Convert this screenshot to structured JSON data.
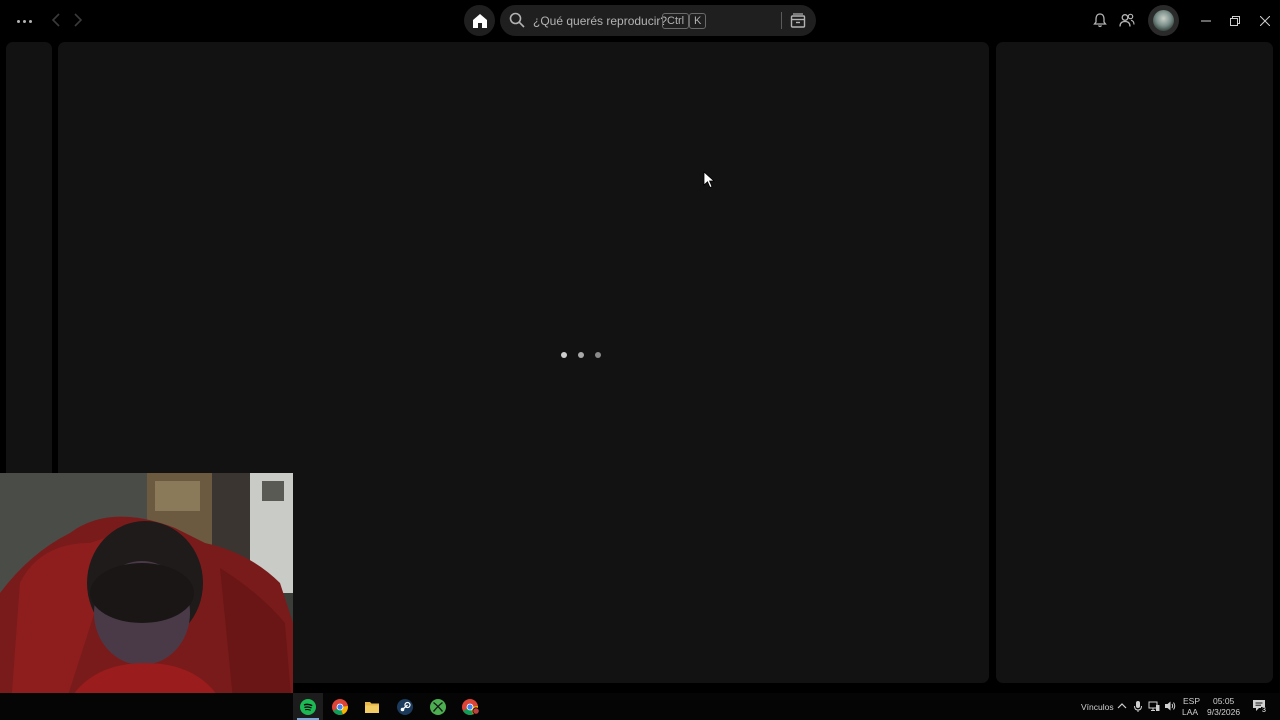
{
  "topbar": {
    "search_placeholder": "¿Qué querés reproducir?",
    "shortcut_ctrl": "Ctrl",
    "shortcut_k": "K"
  },
  "icons": {
    "menu": "more-dots-icon",
    "back": "chevron-left-icon",
    "forward": "chevron-right-icon",
    "home": "home-icon",
    "search": "search-icon",
    "browse": "browse-icon",
    "notifications": "bell-icon",
    "friends": "friend-activity-icon",
    "window_minimize": "minimize-icon",
    "window_restore": "restore-icon",
    "window_close": "close-icon"
  },
  "main": {
    "state": "loading"
  },
  "taskbar": {
    "apps": [
      "spotify",
      "chrome",
      "file-explorer",
      "steam",
      "xbox",
      "chrome-profile"
    ],
    "tray": {
      "links_label": "Vínculos",
      "lang_top": "ESP",
      "lang_bottom": "LAA",
      "time": "05:05",
      "date": "9/3/2026",
      "notification_count": "3"
    }
  },
  "colors": {
    "background": "#000000",
    "panel": "#121212",
    "search_bg": "#1f1f1f",
    "spotify_green": "#1db954"
  }
}
